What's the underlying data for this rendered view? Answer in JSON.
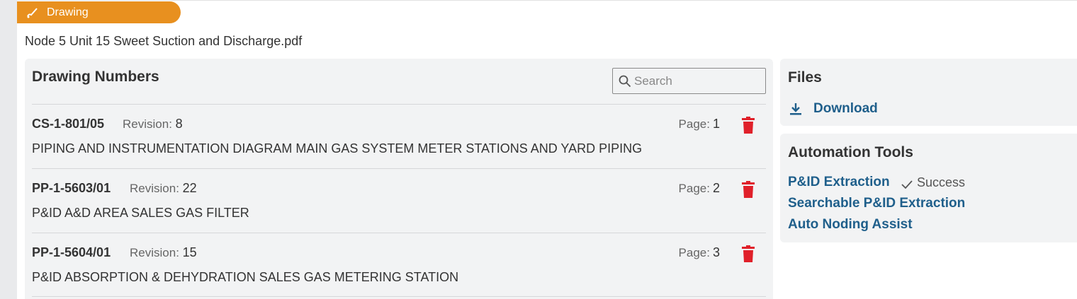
{
  "header": {
    "tag_label": "Drawing",
    "filename": "Node 5 Unit 15 Sweet Suction and Discharge.pdf"
  },
  "drawings": {
    "title": "Drawing Numbers",
    "search_placeholder": "Search",
    "revision_label": "Revision:",
    "page_label": "Page:",
    "rows": [
      {
        "code": "CS-1-801/05",
        "revision": "8",
        "page": "1",
        "description": "PIPING AND INSTRUMENTATION DIAGRAM MAIN GAS SYSTEM METER STATIONS AND YARD PIPING"
      },
      {
        "code": "PP-1-5603/01",
        "revision": "22",
        "page": "2",
        "description": "P&ID A&D AREA SALES GAS FILTER"
      },
      {
        "code": "PP-1-5604/01",
        "revision": "15",
        "page": "3",
        "description": "P&ID ABSORPTION & DEHYDRATION SALES GAS METERING STATION"
      }
    ]
  },
  "files": {
    "title": "Files",
    "download_label": "Download"
  },
  "automation": {
    "title": "Automation Tools",
    "tools": [
      "P&ID Extraction",
      "Searchable P&ID Extraction",
      "Auto Noding Assist"
    ],
    "status": "Success"
  },
  "colors": {
    "accent": "#e8901f",
    "link": "#1f5f8b",
    "danger": "#e0202a"
  },
  "icons": {
    "tag": "drawing-icon",
    "search": "search-icon",
    "delete": "trash-icon",
    "download": "download-icon",
    "status": "check-icon"
  }
}
